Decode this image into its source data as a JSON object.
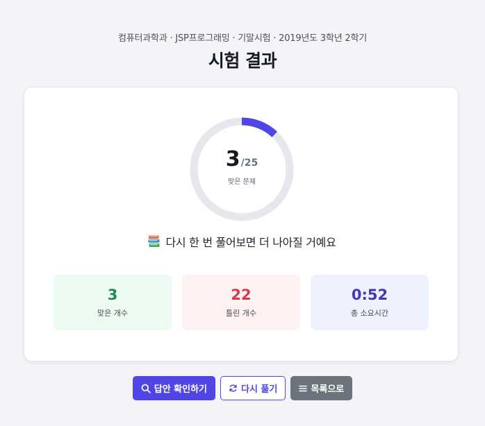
{
  "header": {
    "breadcrumb": "컴퓨터과학과 · JSP프로그래밍 · 기말시험 · 2019년도 3학년 2학기",
    "title": "시험 결과"
  },
  "result": {
    "correct": 3,
    "total": 25,
    "total_display": "/25",
    "correct_display": "3",
    "caption": "맞은 문제",
    "message": "다시 한 번 풀어보면 더 나아질 거예요",
    "message_icon": "books-icon"
  },
  "stats": [
    {
      "value": "3",
      "label": "맞은 개수"
    },
    {
      "value": "22",
      "label": "틀린 개수"
    },
    {
      "value": "0:52",
      "label": "총 소요시간"
    }
  ],
  "actions": {
    "check_answers": {
      "label": "답안 확인하기",
      "icon": "search-icon"
    },
    "retry": {
      "label": "다시 풀기",
      "icon": "refresh-icon"
    },
    "list": {
      "label": "목록으로",
      "icon": "list-icon"
    }
  },
  "colors": {
    "accent": "#4f46e5",
    "gauge_track": "#e6e7ec",
    "correct": "#1e8a4f",
    "wrong": "#d93a4a",
    "time": "#3f39b6",
    "secondary": "#6c737d"
  }
}
